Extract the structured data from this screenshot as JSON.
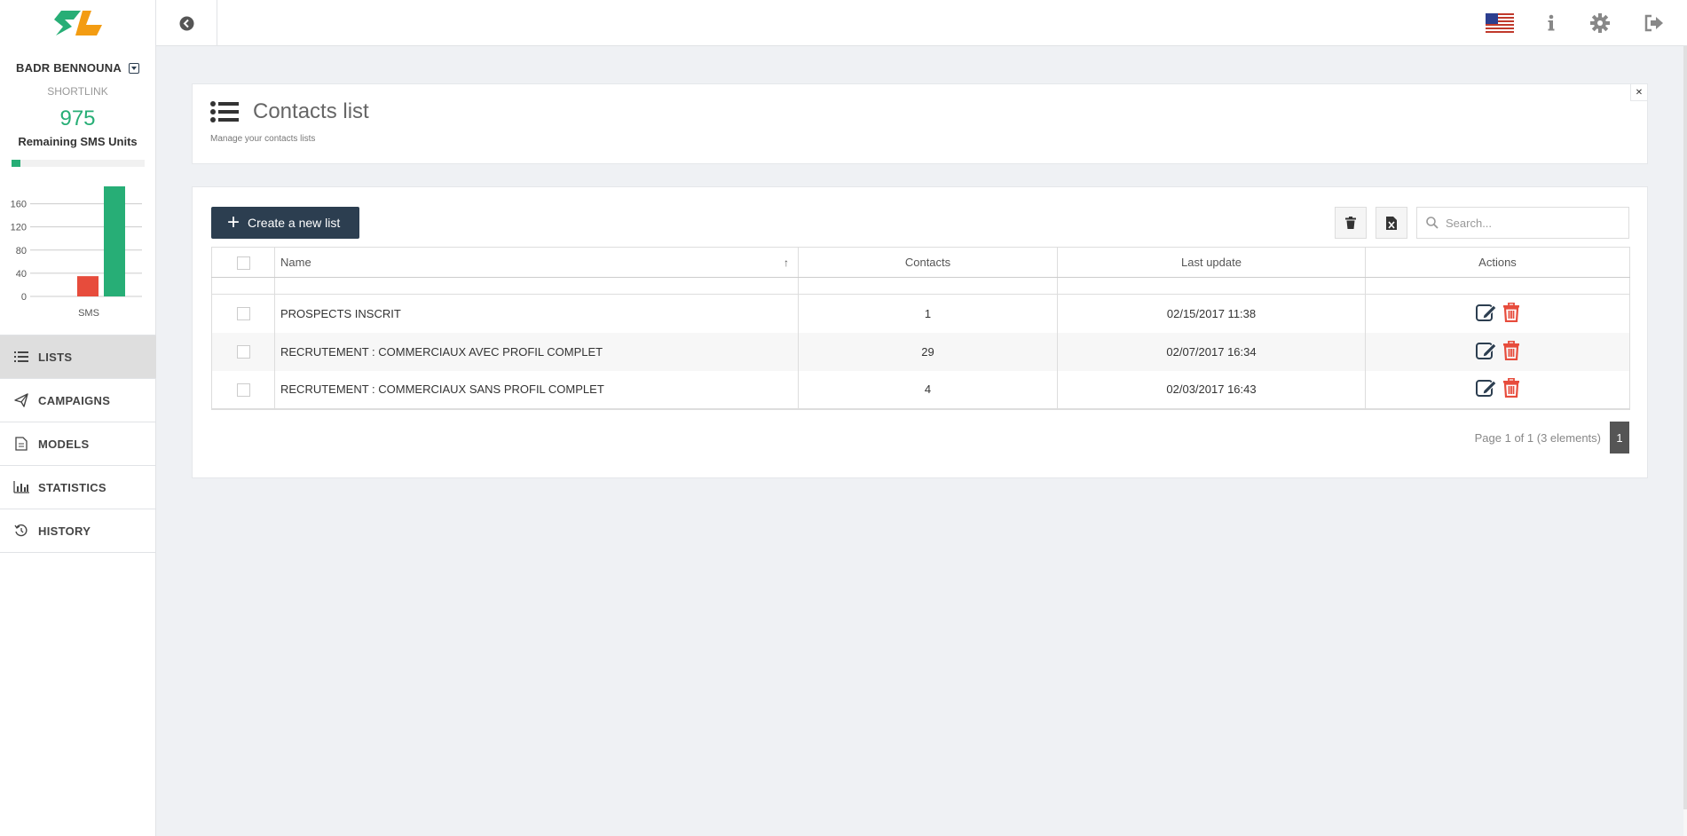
{
  "sidebar": {
    "user_name": "BADR BENNOUNA",
    "company": "SHORTLINK",
    "sms_remaining": "975",
    "sms_label": "Remaining SMS Units",
    "sms_progress_fraction": 0.07,
    "nav": [
      {
        "label": "LISTS",
        "icon": "list-icon",
        "active": true
      },
      {
        "label": "CAMPAIGNS",
        "icon": "paper-plane-icon",
        "active": false
      },
      {
        "label": "MODELS",
        "icon": "document-icon",
        "active": false
      },
      {
        "label": "STATISTICS",
        "icon": "bar-chart-icon",
        "active": false
      },
      {
        "label": "HISTORY",
        "icon": "history-icon",
        "active": false
      }
    ]
  },
  "chart_data": {
    "type": "bar",
    "categories": [
      "SMS"
    ],
    "series": [
      {
        "values": [
          35
        ],
        "color": "#e74c3c"
      },
      {
        "values": [
          190
        ],
        "color": "#27ae76"
      }
    ],
    "xlabel": "SMS",
    "ylabel": "",
    "yticks": [
      0,
      40,
      80,
      120,
      160
    ],
    "ylim": [
      0,
      190
    ],
    "grid": true
  },
  "topbar": {
    "icons": [
      "us-flag-icon",
      "info-icon",
      "gear-icon",
      "logout-icon"
    ]
  },
  "header": {
    "title": "Contacts list",
    "subtitle": "Manage your contacts lists"
  },
  "toolbar": {
    "create_label": "Create a new list",
    "search_placeholder": "Search..."
  },
  "table": {
    "columns": {
      "name": "Name",
      "contacts": "Contacts",
      "last_update": "Last update",
      "actions": "Actions"
    },
    "rows": [
      {
        "name": "PROSPECTS INSCRIT",
        "contacts": "1",
        "last_update": "02/15/2017 11:38"
      },
      {
        "name": "RECRUTEMENT : COMMERCIAUX AVEC PROFIL COMPLET",
        "contacts": "29",
        "last_update": "02/07/2017 16:34"
      },
      {
        "name": "RECRUTEMENT : COMMERCIAUX SANS PROFIL COMPLET",
        "contacts": "4",
        "last_update": "02/03/2017 16:43"
      }
    ]
  },
  "pagination": {
    "info": "Page 1 of 1 (3 elements)",
    "current": "1"
  },
  "colors": {
    "accent": "#27ae76",
    "primary": "#2c3e50",
    "danger": "#e74c3c",
    "logo_green": "#27ae76",
    "logo_orange": "#f39c12"
  }
}
